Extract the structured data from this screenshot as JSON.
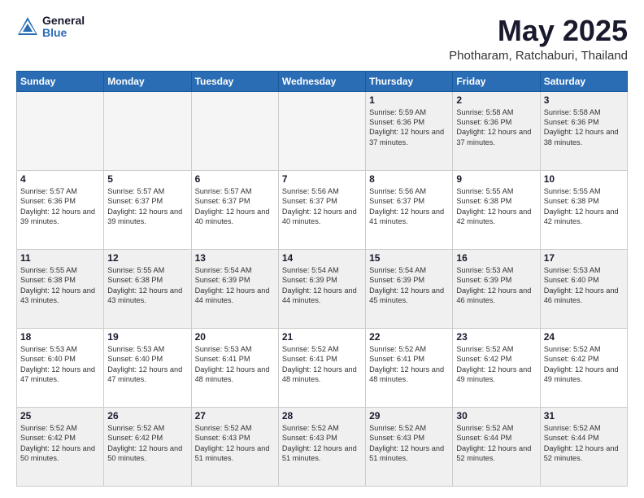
{
  "logo": {
    "general": "General",
    "blue": "Blue"
  },
  "header": {
    "month": "May 2025",
    "location": "Photharam, Ratchaburi, Thailand"
  },
  "days_of_week": [
    "Sunday",
    "Monday",
    "Tuesday",
    "Wednesday",
    "Thursday",
    "Friday",
    "Saturday"
  ],
  "weeks": [
    [
      {
        "day": "",
        "empty": true
      },
      {
        "day": "",
        "empty": true
      },
      {
        "day": "",
        "empty": true
      },
      {
        "day": "",
        "empty": true
      },
      {
        "day": "1",
        "sunrise": "5:59 AM",
        "sunset": "6:36 PM",
        "daylight": "12 hours and 37 minutes."
      },
      {
        "day": "2",
        "sunrise": "5:58 AM",
        "sunset": "6:36 PM",
        "daylight": "12 hours and 37 minutes."
      },
      {
        "day": "3",
        "sunrise": "5:58 AM",
        "sunset": "6:36 PM",
        "daylight": "12 hours and 38 minutes."
      }
    ],
    [
      {
        "day": "4",
        "sunrise": "5:57 AM",
        "sunset": "6:36 PM",
        "daylight": "12 hours and 39 minutes."
      },
      {
        "day": "5",
        "sunrise": "5:57 AM",
        "sunset": "6:37 PM",
        "daylight": "12 hours and 39 minutes."
      },
      {
        "day": "6",
        "sunrise": "5:57 AM",
        "sunset": "6:37 PM",
        "daylight": "12 hours and 40 minutes."
      },
      {
        "day": "7",
        "sunrise": "5:56 AM",
        "sunset": "6:37 PM",
        "daylight": "12 hours and 40 minutes."
      },
      {
        "day": "8",
        "sunrise": "5:56 AM",
        "sunset": "6:37 PM",
        "daylight": "12 hours and 41 minutes."
      },
      {
        "day": "9",
        "sunrise": "5:55 AM",
        "sunset": "6:38 PM",
        "daylight": "12 hours and 42 minutes."
      },
      {
        "day": "10",
        "sunrise": "5:55 AM",
        "sunset": "6:38 PM",
        "daylight": "12 hours and 42 minutes."
      }
    ],
    [
      {
        "day": "11",
        "sunrise": "5:55 AM",
        "sunset": "6:38 PM",
        "daylight": "12 hours and 43 minutes."
      },
      {
        "day": "12",
        "sunrise": "5:55 AM",
        "sunset": "6:38 PM",
        "daylight": "12 hours and 43 minutes."
      },
      {
        "day": "13",
        "sunrise": "5:54 AM",
        "sunset": "6:39 PM",
        "daylight": "12 hours and 44 minutes."
      },
      {
        "day": "14",
        "sunrise": "5:54 AM",
        "sunset": "6:39 PM",
        "daylight": "12 hours and 44 minutes."
      },
      {
        "day": "15",
        "sunrise": "5:54 AM",
        "sunset": "6:39 PM",
        "daylight": "12 hours and 45 minutes."
      },
      {
        "day": "16",
        "sunrise": "5:53 AM",
        "sunset": "6:39 PM",
        "daylight": "12 hours and 46 minutes."
      },
      {
        "day": "17",
        "sunrise": "5:53 AM",
        "sunset": "6:40 PM",
        "daylight": "12 hours and 46 minutes."
      }
    ],
    [
      {
        "day": "18",
        "sunrise": "5:53 AM",
        "sunset": "6:40 PM",
        "daylight": "12 hours and 47 minutes."
      },
      {
        "day": "19",
        "sunrise": "5:53 AM",
        "sunset": "6:40 PM",
        "daylight": "12 hours and 47 minutes."
      },
      {
        "day": "20",
        "sunrise": "5:53 AM",
        "sunset": "6:41 PM",
        "daylight": "12 hours and 48 minutes."
      },
      {
        "day": "21",
        "sunrise": "5:52 AM",
        "sunset": "6:41 PM",
        "daylight": "12 hours and 48 minutes."
      },
      {
        "day": "22",
        "sunrise": "5:52 AM",
        "sunset": "6:41 PM",
        "daylight": "12 hours and 48 minutes."
      },
      {
        "day": "23",
        "sunrise": "5:52 AM",
        "sunset": "6:42 PM",
        "daylight": "12 hours and 49 minutes."
      },
      {
        "day": "24",
        "sunrise": "5:52 AM",
        "sunset": "6:42 PM",
        "daylight": "12 hours and 49 minutes."
      }
    ],
    [
      {
        "day": "25",
        "sunrise": "5:52 AM",
        "sunset": "6:42 PM",
        "daylight": "12 hours and 50 minutes."
      },
      {
        "day": "26",
        "sunrise": "5:52 AM",
        "sunset": "6:42 PM",
        "daylight": "12 hours and 50 minutes."
      },
      {
        "day": "27",
        "sunrise": "5:52 AM",
        "sunset": "6:43 PM",
        "daylight": "12 hours and 51 minutes."
      },
      {
        "day": "28",
        "sunrise": "5:52 AM",
        "sunset": "6:43 PM",
        "daylight": "12 hours and 51 minutes."
      },
      {
        "day": "29",
        "sunrise": "5:52 AM",
        "sunset": "6:43 PM",
        "daylight": "12 hours and 51 minutes."
      },
      {
        "day": "30",
        "sunrise": "5:52 AM",
        "sunset": "6:44 PM",
        "daylight": "12 hours and 52 minutes."
      },
      {
        "day": "31",
        "sunrise": "5:52 AM",
        "sunset": "6:44 PM",
        "daylight": "12 hours and 52 minutes."
      }
    ]
  ]
}
